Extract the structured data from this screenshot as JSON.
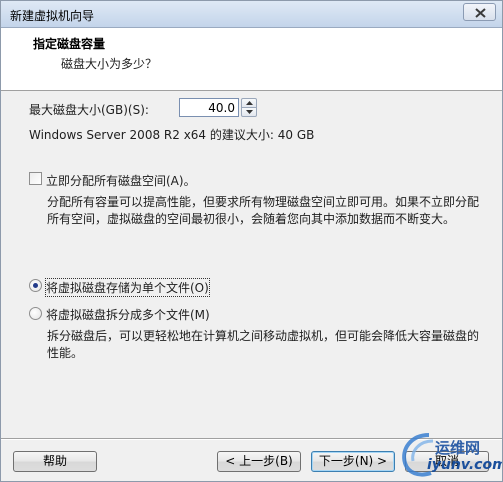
{
  "window": {
    "title": "新建虚拟机向导"
  },
  "header": {
    "title": "指定磁盘容量",
    "subtitle": "磁盘大小为多少？"
  },
  "disk_size": {
    "label": "最大磁盘大小(GB)(S):",
    "value": "40.0",
    "recommended": "Windows Server 2008 R2 x64 的建议大小: 40 GB"
  },
  "allocate": {
    "label": "立即分配所有磁盘空间(A)。",
    "checked": false,
    "description": "分配所有容量可以提高性能，但要求所有物理磁盘空间立即可用。如果不立即分配所有空间，虚拟磁盘的空间最初很小，会随着您向其中添加数据而不断变大。"
  },
  "storage": {
    "selected": "single",
    "single_label": "将虚拟磁盘存储为单个文件(O)",
    "split_label": "将虚拟磁盘拆分成多个文件(M)",
    "split_description": "拆分磁盘后，可以更轻松地在计算机之间移动虚拟机，但可能会降低大容量磁盘的性能。"
  },
  "buttons": {
    "help": "帮助",
    "back": "< 上一步(B)",
    "next": "下一步(N) >",
    "cancel": "取消"
  },
  "watermark": {
    "brand": "运维网",
    "url": "iyunv.com"
  },
  "colors": {
    "accent": "#3c7fb1",
    "radio_dot": "#233b8a",
    "watermark": "#2f5fa7"
  }
}
